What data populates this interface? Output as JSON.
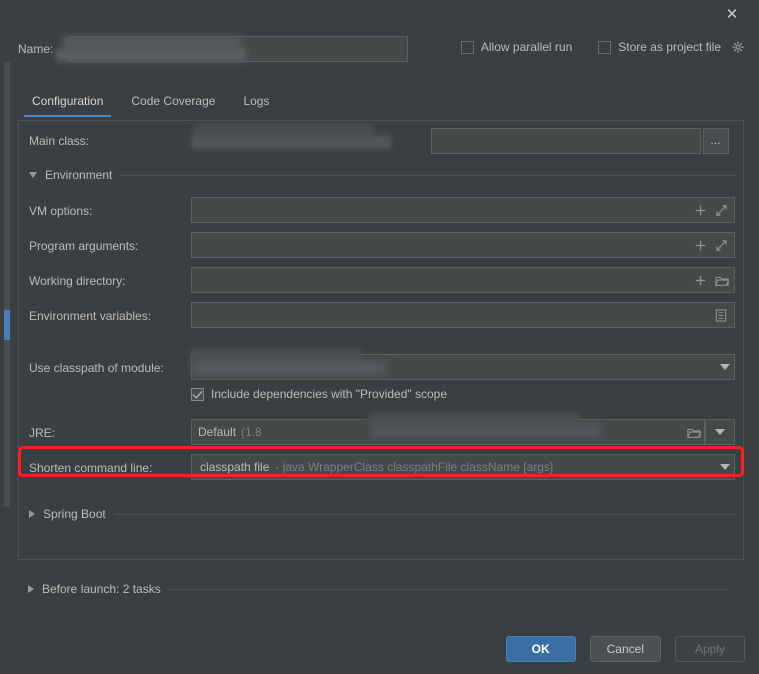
{
  "window": {
    "close_label": "✕"
  },
  "header": {
    "name_label": "Name:",
    "name_value": "",
    "allow_parallel_run": "Allow parallel run",
    "store_as_project_file": "Store as project file"
  },
  "tabs": [
    {
      "label": "Configuration",
      "active": true
    },
    {
      "label": "Code Coverage",
      "active": false
    },
    {
      "label": "Logs",
      "active": false
    }
  ],
  "form": {
    "main_class_label": "Main class:",
    "main_class_value": "",
    "browse_button": "…",
    "environment_section": "Environment",
    "vm_options_label": "VM options:",
    "vm_options_value": "",
    "program_arguments_label": "Program arguments:",
    "program_arguments_value": "",
    "working_directory_label": "Working directory:",
    "working_directory_value": "",
    "environment_variables_label": "Environment variables:",
    "environment_variables_value": "",
    "use_classpath_label": "Use classpath of module:",
    "use_classpath_value": "",
    "include_dependencies_label": "Include dependencies with \"Provided\" scope",
    "jre_label": "JRE:",
    "jre_value": "Default",
    "jre_value_hint": "(1.8",
    "shorten_command_line_label": "Shorten command line:",
    "shorten_command_line_value": "classpath file",
    "shorten_command_line_hint": "- java WrapperClass classpathFile className [args]",
    "spring_boot_section": "Spring Boot"
  },
  "before_launch": {
    "label": "Before launch: 2 tasks"
  },
  "footer": {
    "ok": "OK",
    "cancel": "Cancel",
    "apply": "Apply"
  },
  "colors": {
    "background": "#3c3f41",
    "field": "#45494a",
    "accent": "#4a88c7",
    "primary_button": "#3b6ea5",
    "highlight": "#ff1d1d",
    "text": "#bbbbbb",
    "hint_text": "#7b7f81"
  }
}
